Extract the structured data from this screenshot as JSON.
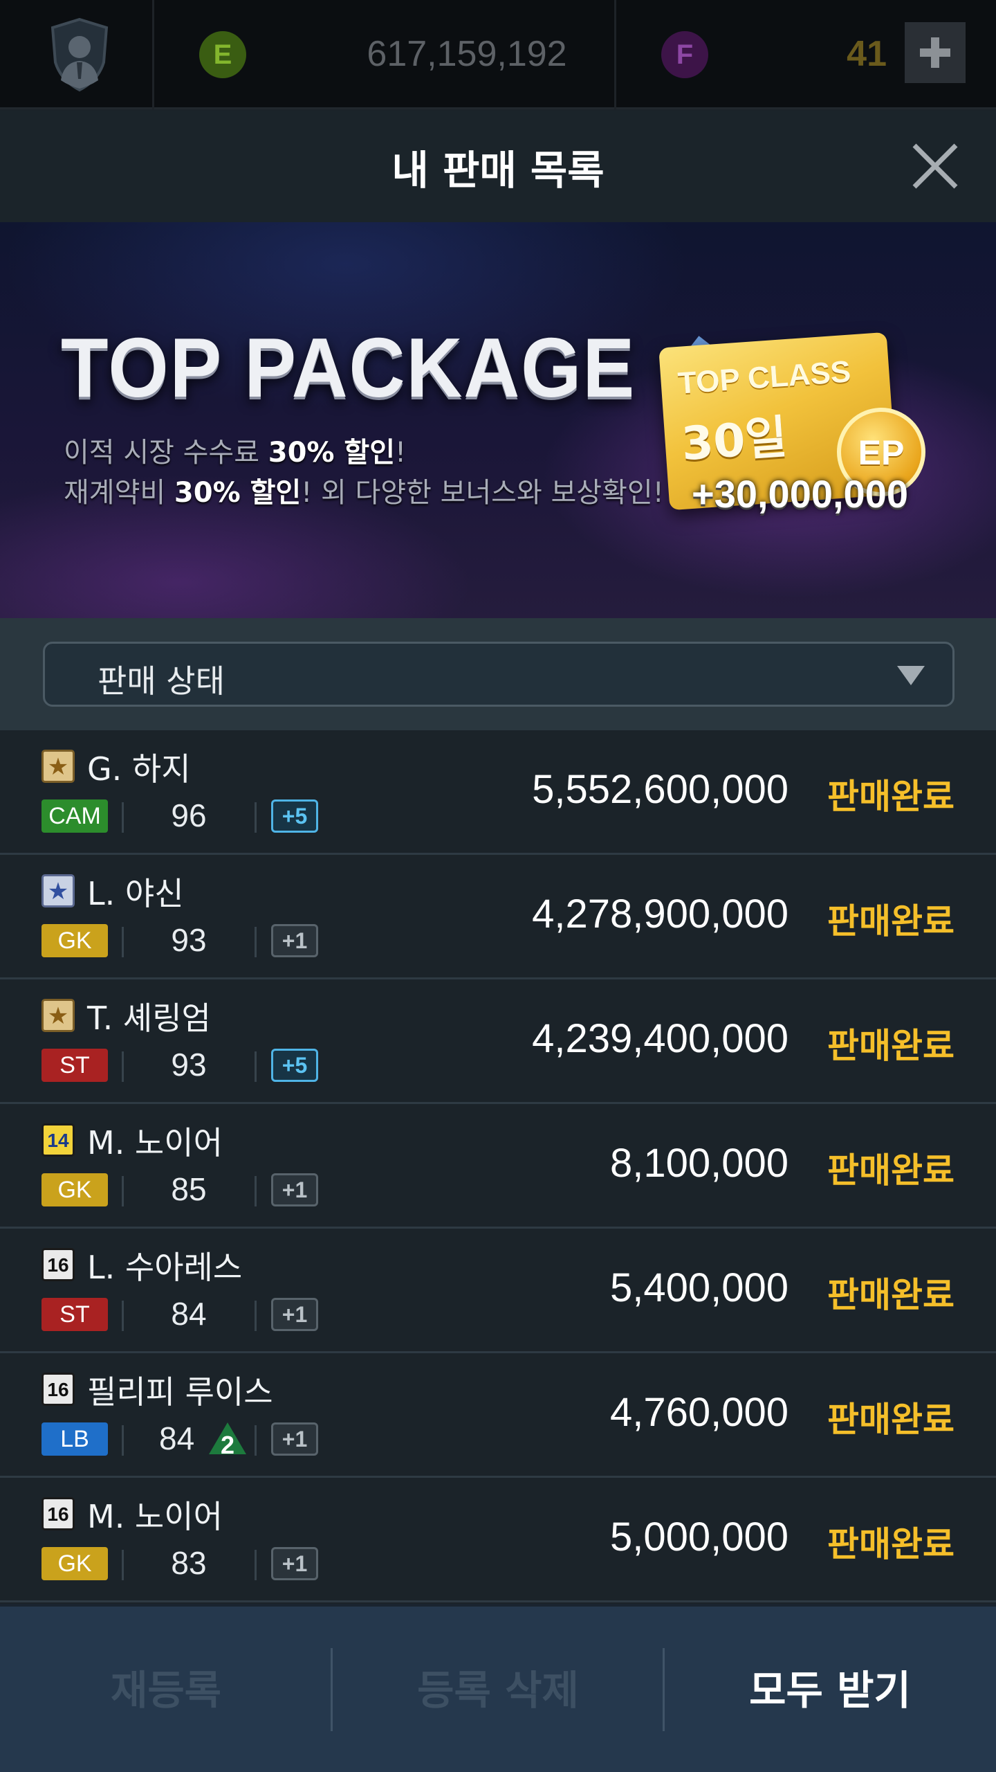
{
  "currency": {
    "ep_label": "E",
    "ep_amount": "617,159,192",
    "fc_label": "F",
    "fc_amount": "41"
  },
  "title": "내 판매 목록",
  "banner": {
    "title": "TOP PACKAGE",
    "line1_prefix": "이적 시장 수수료 ",
    "line1_highlight": "30% 할인",
    "line1_suffix": "!",
    "line2_prefix": "재계약비 ",
    "line2_highlight": "30% 할인",
    "line2_suffix": "! 외 다양한 보너스와 보상확인!",
    "card_title": "TOP CLASS",
    "card_days": "30일",
    "card_coin": "EP",
    "card_bonus": "+30,000,000"
  },
  "filter": {
    "label": "판매 상태"
  },
  "rows": [
    {
      "season_icon": "star-gold-icon",
      "season_text": "★",
      "name": "G. 하지",
      "position": "CAM",
      "ovr": "96",
      "grade": "+5",
      "price": "5,552,600,000",
      "status": "판매완료"
    },
    {
      "season_icon": "star-blue-icon",
      "season_text": "★",
      "name": "L. 야신",
      "position": "GK",
      "ovr": "93",
      "grade": "+1",
      "price": "4,278,900,000",
      "status": "판매완료"
    },
    {
      "season_icon": "star-gold-icon",
      "season_text": "★",
      "name": "T. 셰링엄",
      "position": "ST",
      "ovr": "93",
      "grade": "+5",
      "price": "4,239,400,000",
      "status": "판매완료"
    },
    {
      "season_icon": "season-14-icon",
      "season_text": "14",
      "name": "M. 노이어",
      "position": "GK",
      "ovr": "85",
      "grade": "+1",
      "price": "8,100,000",
      "status": "판매완료"
    },
    {
      "season_icon": "season-16-icon",
      "season_text": "16",
      "name": "L. 수아레스",
      "position": "ST",
      "ovr": "84",
      "grade": "+1",
      "price": "5,400,000",
      "status": "판매완료"
    },
    {
      "season_icon": "season-16-icon",
      "season_text": "16",
      "name": "필리피 루이스",
      "position": "LB",
      "ovr": "84",
      "ovr_up": "2",
      "grade": "+1",
      "price": "4,760,000",
      "status": "판매완료"
    },
    {
      "season_icon": "season-16-icon",
      "season_text": "16",
      "name": "M. 노이어",
      "position": "GK",
      "ovr": "83",
      "grade": "+1",
      "price": "5,000,000",
      "status": "판매완료"
    }
  ],
  "bottom": {
    "relist": "재등록",
    "delete": "등록 삭제",
    "receive_all": "모두 받기"
  },
  "colors": {
    "status": "#f5bf2a",
    "cam": "#2c8d2c",
    "gk": "#caa21c",
    "st": "#a92222",
    "lb": "#1f6fc9"
  }
}
